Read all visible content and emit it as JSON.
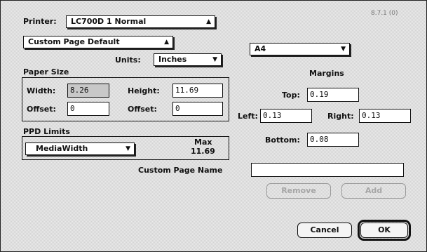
{
  "header": {
    "printer_label": "Printer:",
    "printer_value": "LC700D 1 Normal",
    "version": "8.7.1 (0)"
  },
  "preset": {
    "value": "Custom Page Default"
  },
  "units": {
    "label": "Units:",
    "value": "Inches"
  },
  "paper_select": {
    "value": "A4"
  },
  "paper_size": {
    "title": "Paper Size",
    "width_label": "Width:",
    "width_value": "8.26",
    "height_label": "Height:",
    "height_value": "11.69",
    "offset1_label": "Offset:",
    "offset1_value": "0",
    "offset2_label": "Offset:",
    "offset2_value": "0"
  },
  "margins": {
    "title": "Margins",
    "top_label": "Top:",
    "top_value": "0.19",
    "left_label": "Left:",
    "left_value": "0.13",
    "right_label": "Right:",
    "right_value": "0.13",
    "bottom_label": "Bottom:",
    "bottom_value": "0.08"
  },
  "ppd_limits": {
    "title": "PPD Limits",
    "select_value": "MediaWidth",
    "max_label": "Max",
    "max_value": "11.69"
  },
  "custom_name": {
    "label": "Custom Page Name",
    "value": ""
  },
  "buttons": {
    "remove": "Remove",
    "add": "Add",
    "cancel": "Cancel",
    "ok": "OK"
  },
  "icons": {
    "popup_arrow": "double-arrow-icon",
    "menu_arrow": "down-triangle-icon"
  }
}
